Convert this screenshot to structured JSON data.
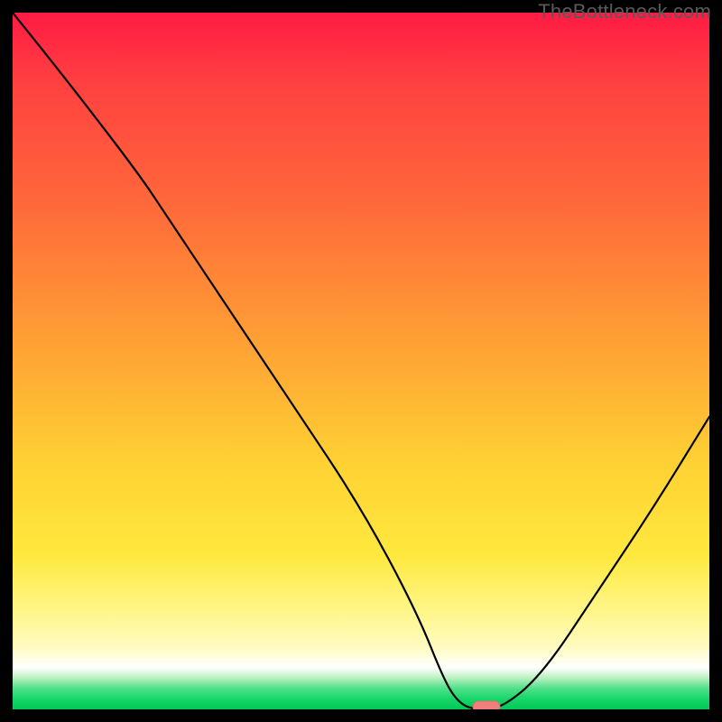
{
  "watermark": "TheBottleneck.com",
  "colors": {
    "frame": "#000000",
    "curve": "#000000",
    "marker_fill": "#ef7f7a",
    "marker_stroke": "#de6f6a"
  },
  "chart_data": {
    "type": "line",
    "title": "",
    "xlabel": "",
    "ylabel": "",
    "xlim": [
      0,
      100
    ],
    "ylim": [
      0,
      100
    ],
    "grid": false,
    "legend": false,
    "series": [
      {
        "name": "bottleneck-curve",
        "x": [
          0,
          8,
          18,
          22,
          30,
          40,
          50,
          58,
          62,
          64,
          66,
          70,
          76,
          84,
          92,
          100
        ],
        "values": [
          100,
          90,
          77,
          71,
          59,
          44,
          29,
          14,
          4,
          1,
          0,
          0,
          5,
          17,
          29,
          42
        ]
      }
    ],
    "marker": {
      "x": 68,
      "y": 0
    },
    "gradient_stops": [
      {
        "pos": 0,
        "color": "#ff1b44"
      },
      {
        "pos": 0.5,
        "color": "#ffa834"
      },
      {
        "pos": 0.78,
        "color": "#ffe93f"
      },
      {
        "pos": 0.95,
        "color": "#ffffff"
      },
      {
        "pos": 1.0,
        "color": "#00c853"
      }
    ]
  }
}
